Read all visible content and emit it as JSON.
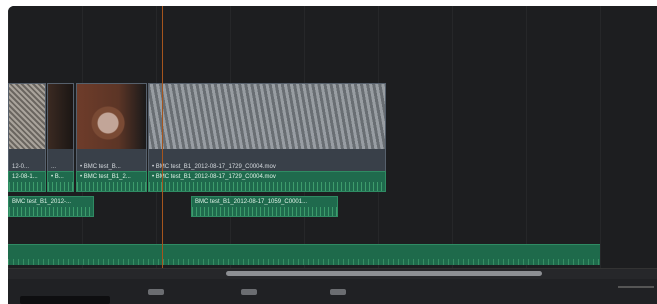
{
  "video_clips": [
    {
      "label": "12-0..."
    },
    {
      "label": "..."
    },
    {
      "label": "• BMC test_B..."
    },
    {
      "label": "• BMC test_B1_2012-08-17_1729_C0004.mov"
    }
  ],
  "audio_track1_clips": [
    {
      "label": "12-08-1..."
    },
    {
      "label": "• B..."
    },
    {
      "label": "• BMC test_B1_2..."
    },
    {
      "label": "• BMC test_B1_2012-08-17_1729_C0004.mov"
    }
  ],
  "audio_track2_clips": [
    {
      "label": "BMC test_B1_2012-..."
    },
    {
      "label": "BMC test_B1_2012-08-17_1059_C0001..."
    }
  ],
  "colors": {
    "playhead": "#a5551d",
    "audio_clip": "#1f6a4d",
    "video_clip": "#394049"
  },
  "icons": [
    "blade-tool-icon",
    "link-icon",
    "snap-icon",
    "flag-icon"
  ]
}
